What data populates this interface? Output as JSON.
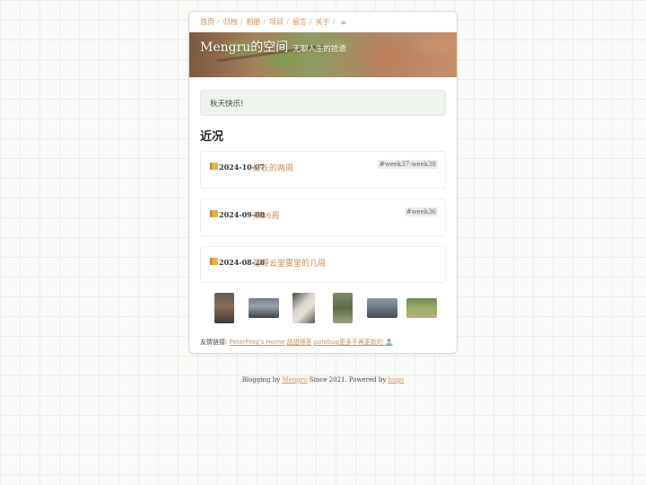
{
  "nav": {
    "items": [
      "首页",
      "归档",
      "相册",
      "项目",
      "留言",
      "关于"
    ],
    "separator": "/",
    "extra_icon": "☕"
  },
  "header": {
    "title": "Mengru的空间",
    "subtitle": "无聊人生的拾遗"
  },
  "notice": "秋天快乐!",
  "section": {
    "title": "近况"
  },
  "posts": [
    {
      "date": "2024-10-07",
      "title": "好长的两周",
      "tag": "#week37-week38"
    },
    {
      "date": "2024-09-08",
      "title": "第36周",
      "tag": "#week36"
    },
    {
      "date": "2024-08-28",
      "title": "活得云里雾里的几周",
      "tag": ""
    }
  ],
  "links": {
    "label": "友情链接:",
    "items": [
      "PeterFrog's Home",
      "甜甜博客",
      "polebug",
      "更多不再更新的 🏝️"
    ]
  },
  "footer": {
    "prefix": "Blogging by",
    "author": "Mengru",
    "middle": "Since 2021. Powered by",
    "engine": "hugo"
  },
  "colors": {
    "accent": "#d08f5c",
    "notice_bg": "#eef3ee",
    "tag_bg": "#ebebea"
  },
  "icons": {
    "post_icon": "notebook-icon",
    "nav_extra": "coffee-icon"
  }
}
